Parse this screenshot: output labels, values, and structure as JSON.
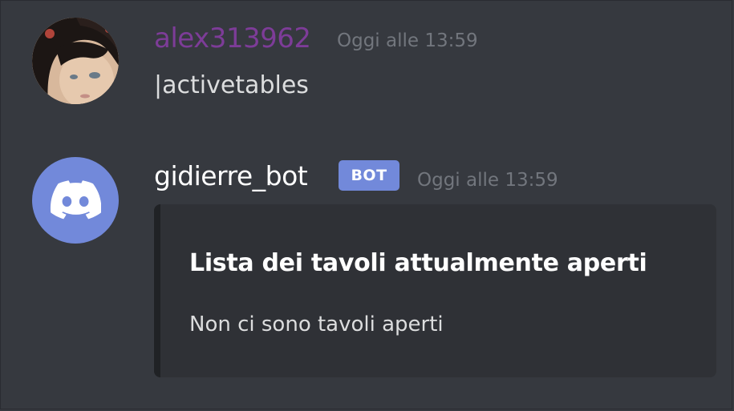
{
  "messages": [
    {
      "author": "alex313962",
      "author_color": "#7d3c98",
      "timestamp": "Oggi alle 13:59",
      "avatar_icon": "user-avatar-photo",
      "content": "|activetables"
    },
    {
      "author": "gidierre_bot",
      "author_color": "#ffffff",
      "bot_tag": "BOT",
      "timestamp": "Oggi alle 13:59",
      "avatar_icon": "discord-logo-icon",
      "embed": {
        "title": "Lista dei tavoli attualmente aperti",
        "description": "Non ci sono tavoli aperti"
      }
    }
  ],
  "colors": {
    "background": "#36393f",
    "embed_background": "#2f3136",
    "bot_tag": "#7289da",
    "timestamp": "#72767d",
    "text": "#dcddde"
  }
}
